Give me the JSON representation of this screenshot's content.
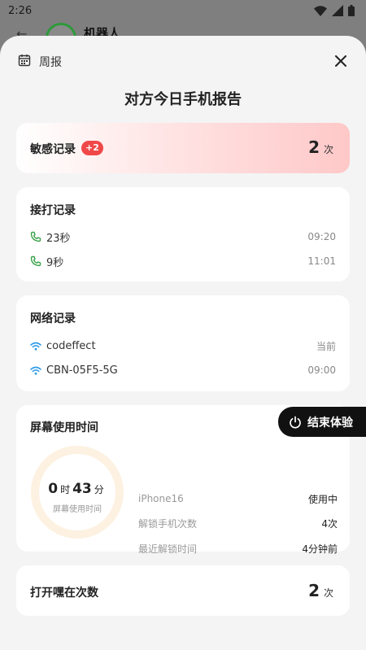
{
  "status_bar": {
    "time": "2:26"
  },
  "behind": {
    "contact_name": "机器人"
  },
  "sheet": {
    "header_label": "周报",
    "title": "对方今日手机报告"
  },
  "sensitive": {
    "title": "敏感记录",
    "badge": "+2",
    "count": "2",
    "unit": "次"
  },
  "calls": {
    "title": "接打记录",
    "items": [
      {
        "label": "23秒",
        "time": "09:20"
      },
      {
        "label": "9秒",
        "time": "11:01"
      }
    ]
  },
  "network": {
    "title": "网络记录",
    "items": [
      {
        "label": "codeffect",
        "time": "当前"
      },
      {
        "label": "CBN-05F5-5G",
        "time": "09:00"
      }
    ]
  },
  "screen_time": {
    "title": "屏幕使用时间",
    "hours": "0",
    "hours_unit": "时",
    "minutes": "43",
    "minutes_unit": "分",
    "ring_label": "屏幕使用时间",
    "device_name": "iPhone16",
    "device_status": "使用中",
    "unlock_label": "解锁手机次数",
    "unlock_value": "4次",
    "last_unlock_label": "最近解锁时间",
    "last_unlock_value": "4分钟前"
  },
  "end_button": {
    "label": "结束体验"
  },
  "open_count": {
    "title": "打开嘿在次数",
    "count": "2",
    "unit": "次"
  },
  "colors": {
    "accent_green": "#3aa14a",
    "wifi_blue": "#2f9be8",
    "badge_red": "#f04848",
    "ring": "#fdf1e1"
  }
}
